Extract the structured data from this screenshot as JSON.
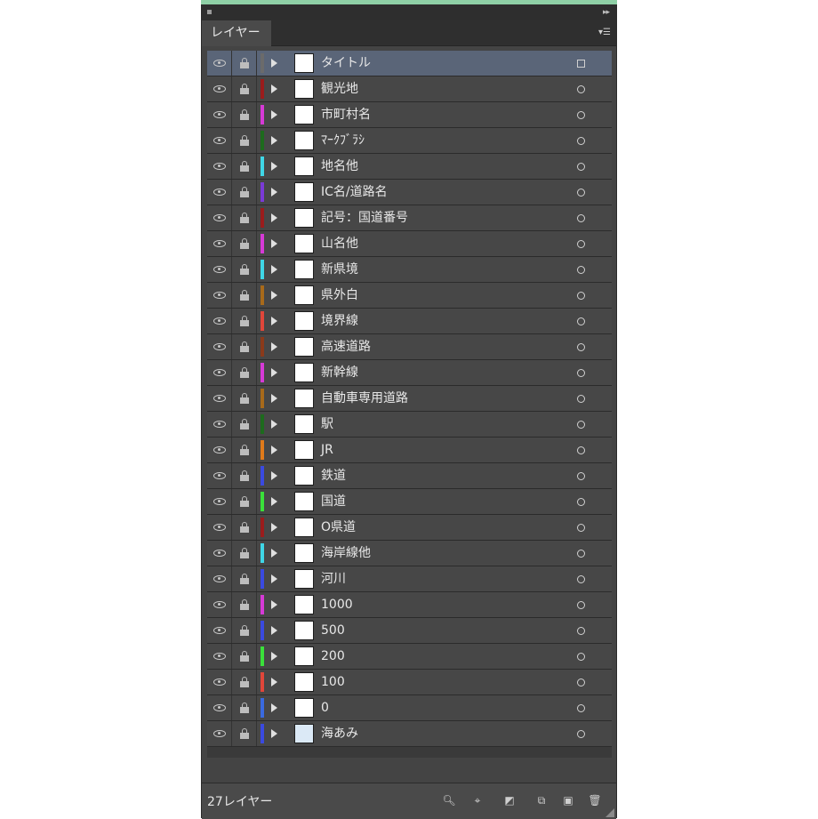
{
  "panel": {
    "tab_label": "レイヤー",
    "menu_icon": "panel-menu-icon",
    "footer": {
      "count_label": "27レイヤー",
      "icons": [
        "search-icon",
        "locate-object-icon",
        "make-clipping-mask-icon",
        "new-sublayer-icon",
        "new-layer-icon",
        "delete-icon"
      ]
    }
  },
  "layers": [
    {
      "name": "タイトル",
      "color": "#6b6b6b",
      "selected": true,
      "target": "square"
    },
    {
      "name": "観光地",
      "color": "#9b1c1c",
      "selected": false,
      "target": "ring"
    },
    {
      "name": "市町村名",
      "color": "#d63ad6",
      "selected": false,
      "target": "ring"
    },
    {
      "name": "ﾏｰｸﾌﾞﾗｼ",
      "color": "#1d6b1d",
      "selected": false,
      "target": "ring"
    },
    {
      "name": "地名他",
      "color": "#3fd6e6",
      "selected": false,
      "target": "ring"
    },
    {
      "name": "IC名/道路名",
      "color": "#7a3ad6",
      "selected": false,
      "target": "ring"
    },
    {
      "name": "記号：国道番号",
      "color": "#9b1c1c",
      "selected": false,
      "target": "ring"
    },
    {
      "name": "山名他",
      "color": "#d63ad6",
      "selected": false,
      "target": "ring"
    },
    {
      "name": "新県境",
      "color": "#3fd6e6",
      "selected": false,
      "target": "ring"
    },
    {
      "name": "県外白",
      "color": "#a86a1a",
      "selected": false,
      "target": "ring"
    },
    {
      "name": "境界線",
      "color": "#e0463a",
      "selected": false,
      "target": "ring"
    },
    {
      "name": "高速道路",
      "color": "#8b3a1a",
      "selected": false,
      "target": "ring"
    },
    {
      "name": "新幹線",
      "color": "#d63ad6",
      "selected": false,
      "target": "ring"
    },
    {
      "name": "自動車専用道路",
      "color": "#a86a1a",
      "selected": false,
      "target": "ring"
    },
    {
      "name": "駅",
      "color": "#1d6b1d",
      "selected": false,
      "target": "ring"
    },
    {
      "name": "JR",
      "color": "#e07a1a",
      "selected": false,
      "target": "ring"
    },
    {
      "name": "鉄道",
      "color": "#3a4ae0",
      "selected": false,
      "target": "ring"
    },
    {
      "name": "国道",
      "color": "#3ae03a",
      "selected": false,
      "target": "ring"
    },
    {
      "name": "O県道",
      "color": "#9b1c1c",
      "selected": false,
      "target": "ring"
    },
    {
      "name": "海岸線他",
      "color": "#3fd6e6",
      "selected": false,
      "target": "ring"
    },
    {
      "name": "河川",
      "color": "#3a4ae0",
      "selected": false,
      "target": "ring"
    },
    {
      "name": "1000",
      "color": "#d63ad6",
      "selected": false,
      "target": "ring"
    },
    {
      "name": "500",
      "color": "#3a4ae0",
      "selected": false,
      "target": "ring"
    },
    {
      "name": "200",
      "color": "#3ae03a",
      "selected": false,
      "target": "ring"
    },
    {
      "name": "100",
      "color": "#e0463a",
      "selected": false,
      "target": "ring"
    },
    {
      "name": "0",
      "color": "#3a6ae0",
      "selected": false,
      "target": "ring"
    },
    {
      "name": "海あみ",
      "color": "#3a4ae0",
      "selected": false,
      "target": "ring",
      "thumb": "sea"
    }
  ]
}
